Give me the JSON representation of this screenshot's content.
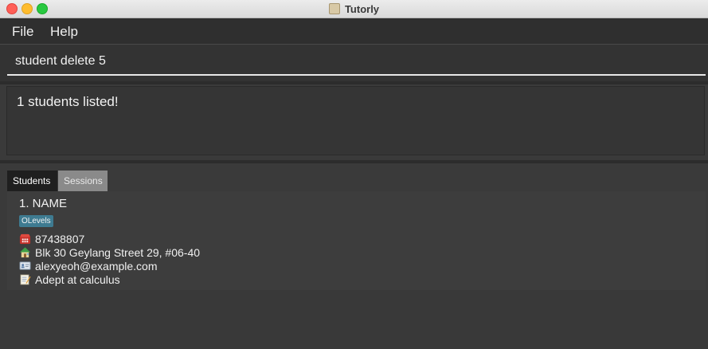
{
  "window": {
    "title": "Tutorly"
  },
  "menu": {
    "file": "File",
    "help": "Help"
  },
  "command": {
    "value": "student delete 5"
  },
  "result": {
    "message": "1 students listed!"
  },
  "tabs": [
    {
      "label": "Students",
      "active": true
    },
    {
      "label": "Sessions",
      "active": false
    }
  ],
  "student": {
    "name": "1. NAME",
    "tag": "OLevels",
    "phone": "87438807",
    "address": "Blk 30 Geylang Street 29, #06-40",
    "email": "alexyeoh@example.com",
    "remark": "Adept at calculus"
  },
  "colors": {
    "tag_bg": "#3e7b91",
    "active_tab_bg": "#1f1f1f",
    "inactive_tab_bg": "#8a8a8a"
  },
  "icons": {
    "phone": "phone-icon",
    "address": "house-icon",
    "email": "email-icon",
    "remark": "memo-icon"
  }
}
